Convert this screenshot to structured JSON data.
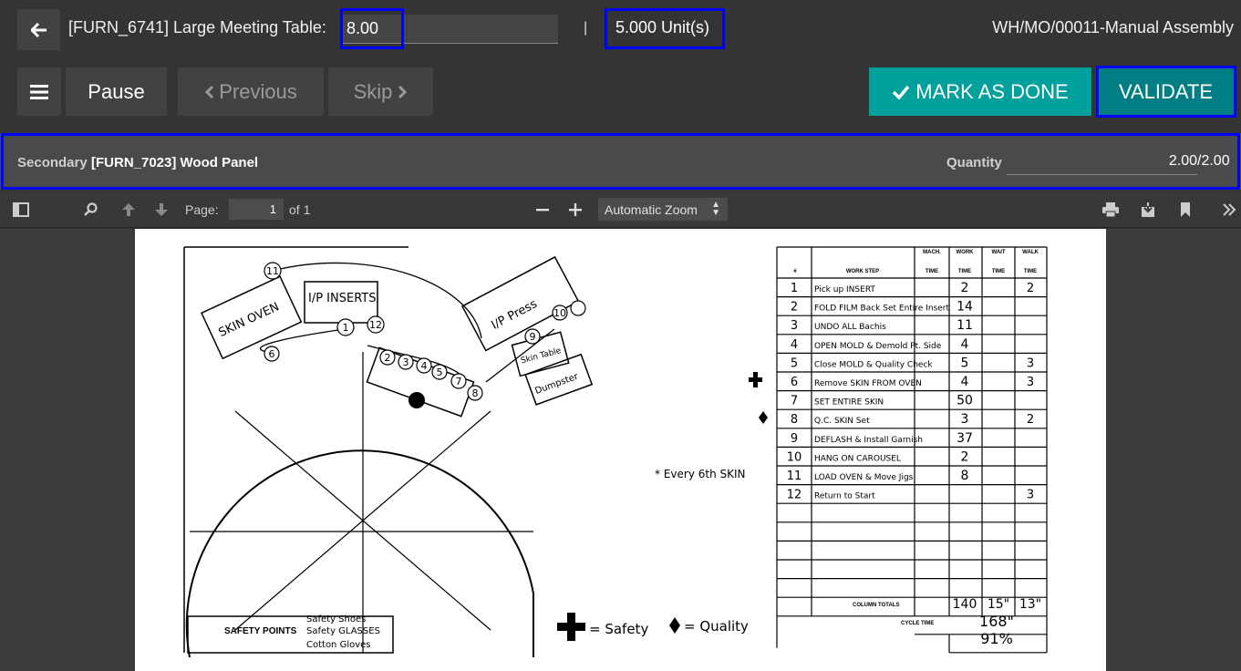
{
  "header": {
    "product_title": "[FURN_6741] Large Meeting Table:",
    "qty_value": "8.00",
    "separator": "|",
    "units": "5.000 Unit(s)",
    "mo_reference": "WH/MO/00011-Manual Assembly"
  },
  "actions": {
    "pause": "Pause",
    "previous": "Previous",
    "skip": "Skip",
    "mark_done": "MARK AS DONE",
    "validate": "VALIDATE"
  },
  "secondary": {
    "label": "Secondary",
    "product": "[FURN_7023] Wood Panel",
    "quantity_label": "Quantity",
    "quantity_value": "2.00",
    "quantity_max": "/2.00"
  },
  "pdf_toolbar": {
    "page_label": "Page:",
    "page_current": "1",
    "page_total": "of 1",
    "zoom": "Automatic Zoom"
  },
  "document": {
    "layout_labels": {
      "skin_oven": "SKIN OVEN",
      "ip_inserts": "I/P INSERTS",
      "ip_press": "I/P Press",
      "skin_table": "Skin Table",
      "dumpster": "Dumpster",
      "every_6th": "* Every 6th SKIN",
      "safety_points_title": "SAFETY POINTS",
      "safety_points": [
        "Safety Shoes",
        "Safety GLASSES",
        "Cotton Gloves"
      ],
      "legend_safety": "= Safety",
      "legend_quality": "= Quality",
      "circle_numbers": [
        "11",
        "1",
        "12",
        "6",
        "2",
        "3",
        "4",
        "5",
        "7",
        "8",
        "9",
        "10"
      ]
    },
    "table": {
      "headers": [
        "#",
        "WORK STEP",
        "MACH. TIME",
        "WORK TIME",
        "WAIT TIME",
        "WALK TIME"
      ],
      "rows": [
        {
          "n": "1",
          "step": "Pick up INSERT",
          "work": "2",
          "walk": "2",
          "mark": ""
        },
        {
          "n": "2",
          "step": "FOLD FILM Back Set Entire Insert",
          "work": "14",
          "walk": "",
          "mark": ""
        },
        {
          "n": "3",
          "step": "UNDO ALL Bachis",
          "work": "11",
          "walk": "",
          "mark": ""
        },
        {
          "n": "4",
          "step": "OPEN MOLD & Demold Pt. Side",
          "work": "4",
          "walk": "",
          "mark": ""
        },
        {
          "n": "5",
          "step": "Close MOLD & Quality Check",
          "work": "5",
          "walk": "3",
          "mark": ""
        },
        {
          "n": "6",
          "step": "Remove SKIN FROM OVEN",
          "work": "4",
          "walk": "3",
          "mark": "safety"
        },
        {
          "n": "7",
          "step": "SET ENTIRE SKIN",
          "work": "50",
          "walk": "",
          "mark": ""
        },
        {
          "n": "8",
          "step": "Q.C. SKIN Set",
          "work": "3",
          "walk": "2",
          "mark": "quality"
        },
        {
          "n": "9",
          "step": "DEFLASH & Install Garnish",
          "work": "37",
          "walk": "",
          "mark": ""
        },
        {
          "n": "10",
          "step": "HANG ON CAROUSEL",
          "work": "2",
          "walk": "",
          "mark": ""
        },
        {
          "n": "11",
          "step": "LOAD OVEN & Move Jigs",
          "work": "8",
          "walk": "",
          "mark": ""
        },
        {
          "n": "12",
          "step": "Return to Start",
          "work": "",
          "walk": "3",
          "mark": ""
        }
      ],
      "column_totals_label": "COLUMN TOTALS",
      "column_totals": {
        "work": "140",
        "wait": "15\"",
        "walk": "13\""
      },
      "cycle_time_label": "CYCLE TIME",
      "cycle_time": "168\"",
      "percent": "91%"
    }
  }
}
